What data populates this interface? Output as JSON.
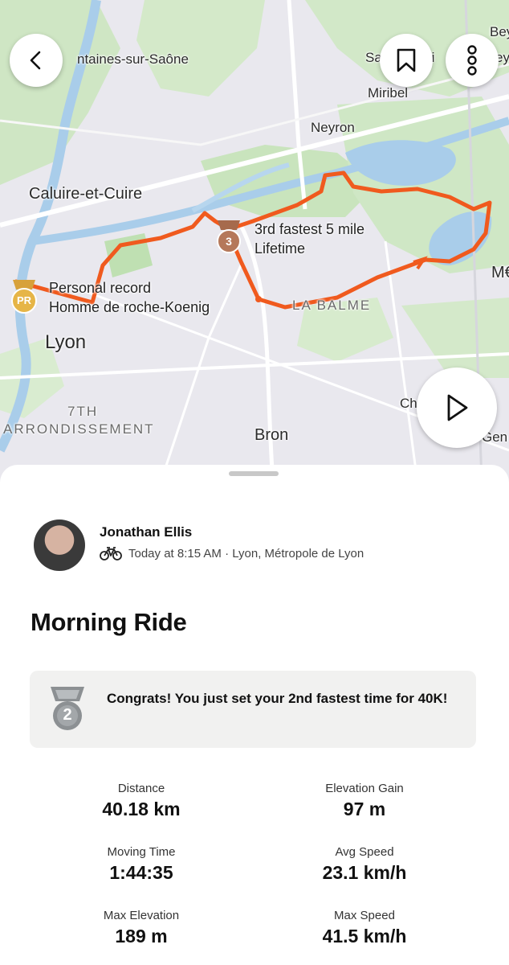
{
  "map": {
    "places": {
      "fontaines": "ntaines-sur-Saône",
      "sainte": "Sa",
      "sainte_tail": "ri",
      "bey_top": "Bey",
      "bey_mid": "ey",
      "miribel": "Miribel",
      "neyron": "Neyron",
      "caluire": "Caluire-et-Cuire",
      "lyon": "Lyon",
      "district_line1": "7TH",
      "district_line2": "ARRONDISSEMENT",
      "la_balme": "LA BALME",
      "bron": "Bron",
      "me": "M€",
      "ch": "Ch",
      "ger": "Gen"
    },
    "callouts": {
      "pr_line1": "Personal record",
      "pr_line2": "Homme de roche-Koenig",
      "pr_badge": "PR",
      "third_line1": "3rd fastest 5 mile",
      "third_line2": "Lifetime",
      "third_badge": "3"
    },
    "route_color": "#f05a1e"
  },
  "buttons": {
    "back_icon": "chevron-left-icon",
    "bookmark_icon": "bookmark-icon",
    "more_icon": "more-vertical-icon",
    "play_icon": "play-icon"
  },
  "athlete": {
    "name": "Jonathan Ellis",
    "meta": "Today at 8:15 AM · Lyon, Métropole de Lyon"
  },
  "activity": {
    "title": "Morning Ride",
    "congrats_badge": "2",
    "congrats_text": "Congrats! You just set your 2nd fastest time for 40K!"
  },
  "stats": [
    {
      "label": "Distance",
      "value": "40.18 km"
    },
    {
      "label": "Elevation Gain",
      "value": "97 m"
    },
    {
      "label": "Moving Time",
      "value": "1:44:35"
    },
    {
      "label": "Avg Speed",
      "value": "23.1 km/h"
    },
    {
      "label": "Max Elevation",
      "value": "189 m"
    },
    {
      "label": "Max Speed",
      "value": "41.5 km/h"
    }
  ]
}
